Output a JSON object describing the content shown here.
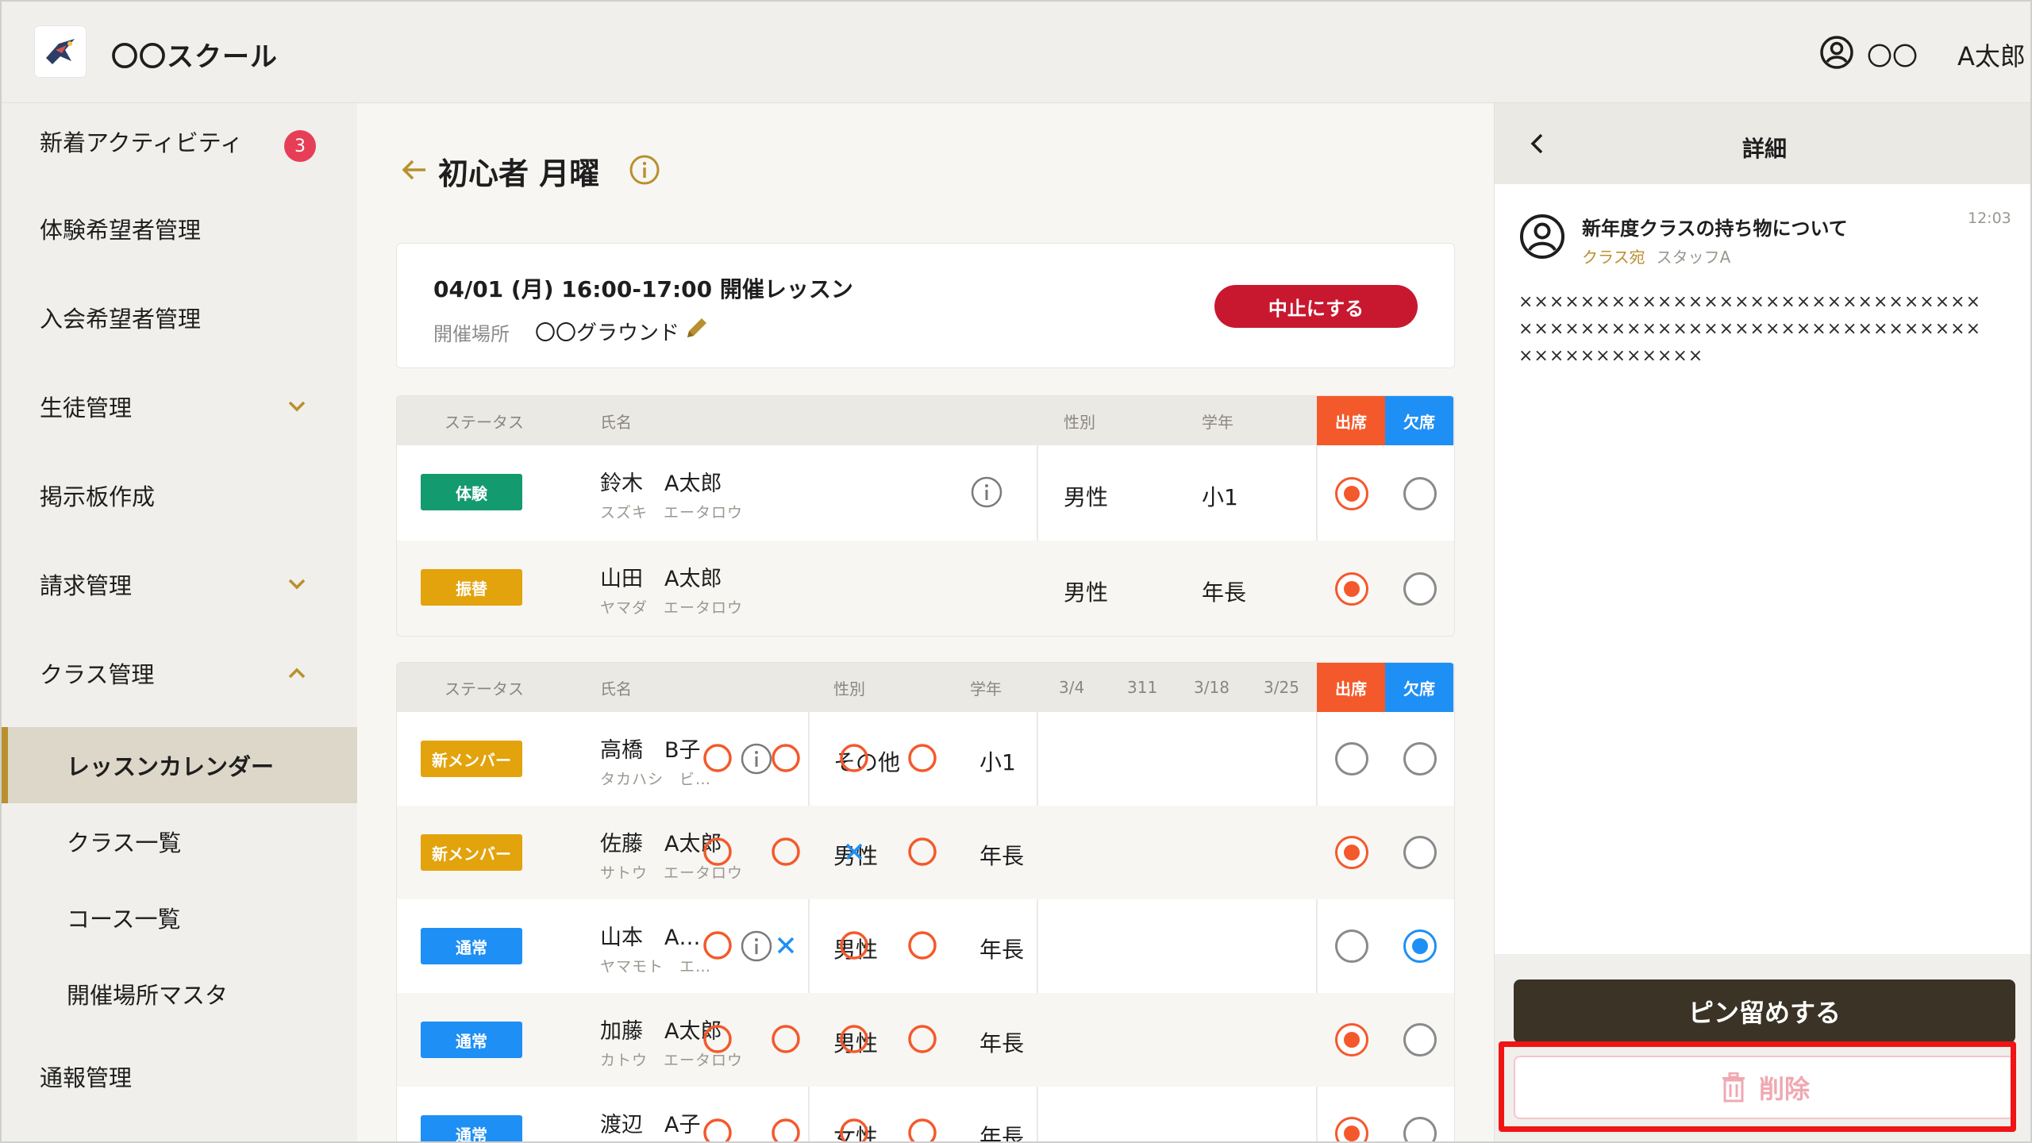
{
  "header": {
    "app_title": "〇〇スクール",
    "user_name_1": "〇〇",
    "user_name_2": "A太郎"
  },
  "sidebar": {
    "items": [
      {
        "label": "新着アクティビティ",
        "badge": "3"
      },
      {
        "label": "体験希望者管理"
      },
      {
        "label": "入会希望者管理"
      },
      {
        "label": "生徒管理"
      },
      {
        "label": "掲示板作成"
      },
      {
        "label": "請求管理"
      },
      {
        "label": "クラス管理"
      },
      {
        "label": "レッスンカレンダー"
      },
      {
        "label": "クラス一覧"
      },
      {
        "label": "コース一覧"
      },
      {
        "label": "開催場所マスタ"
      },
      {
        "label": "通報管理"
      }
    ]
  },
  "page": {
    "title": "初心者 月曜"
  },
  "lesson": {
    "date": "04/01 (月) 16:00-17:00 開催レッスン",
    "place_label": "開催場所",
    "place": "〇〇グラウンド",
    "cancel_label": "中止にする"
  },
  "table1": {
    "headers": {
      "status": "ステータス",
      "name": "氏名",
      "gender": "性別",
      "grade": "学年",
      "attend": "出席",
      "absent": "欠席"
    },
    "rows": [
      {
        "status": "体験",
        "name": "鈴木　A太郎",
        "kana": "スズキ　エータロウ",
        "gender": "男性",
        "grade": "小1",
        "attendance": "attend"
      },
      {
        "status": "振替",
        "name": "山田　A太郎",
        "kana": "ヤマダ　エータロウ",
        "gender": "男性",
        "grade": "年長",
        "attendance": "attend"
      }
    ]
  },
  "table2": {
    "headers": {
      "status": "ステータス",
      "name": "氏名",
      "gender": "性別",
      "grade": "学年",
      "d1": "3/4",
      "d2": "311",
      "d3": "3/18",
      "d4": "3/25",
      "attend": "出席",
      "absent": "欠席"
    },
    "rows": [
      {
        "status": "新メンバー",
        "name": "高橋　B子",
        "kana": "タカハシ　ビ…",
        "gender": "その他",
        "grade": "小1",
        "history": [
          "o",
          "o",
          "o",
          "o"
        ],
        "attendance": "none"
      },
      {
        "status": "新メンバー",
        "name": "佐藤　A太郎",
        "kana": "サトウ　エータロウ",
        "gender": "男性",
        "grade": "年長",
        "history": [
          "o",
          "o",
          "x",
          "o"
        ],
        "attendance": "attend"
      },
      {
        "status": "通常",
        "name": "山本　A…",
        "kana": "ヤマモト　エ…",
        "gender": "男性",
        "grade": "年長",
        "history": [
          "o",
          "x",
          "o",
          "o"
        ],
        "attendance": "absent"
      },
      {
        "status": "通常",
        "name": "加藤　A太郎",
        "kana": "カトウ　エータロウ",
        "gender": "男性",
        "grade": "年長",
        "history": [
          "o",
          "o",
          "o",
          "o"
        ],
        "attendance": "attend"
      },
      {
        "status": "通常",
        "name": "渡辺　A子",
        "kana": "",
        "gender": "女性",
        "grade": "年長",
        "history": [
          "o",
          "o",
          "o",
          "o"
        ],
        "attendance": "attend"
      }
    ]
  },
  "detail": {
    "title": "詳細",
    "message_title": "新年度クラスの持ち物について",
    "to": "クラス宛",
    "staff": "スタッフA",
    "time": "12:03",
    "body": "××××××××××××××××××××××××××××××××××××××××××××××××××××××××××××××××××××××××",
    "pin_label": "ピン留めする",
    "delete_label": "削除"
  },
  "colors": {
    "accent": "#b8902e",
    "attend": "#f4592b",
    "absent": "#1e8ff5",
    "cancel": "#c8182f",
    "highlight": "#f01414"
  }
}
